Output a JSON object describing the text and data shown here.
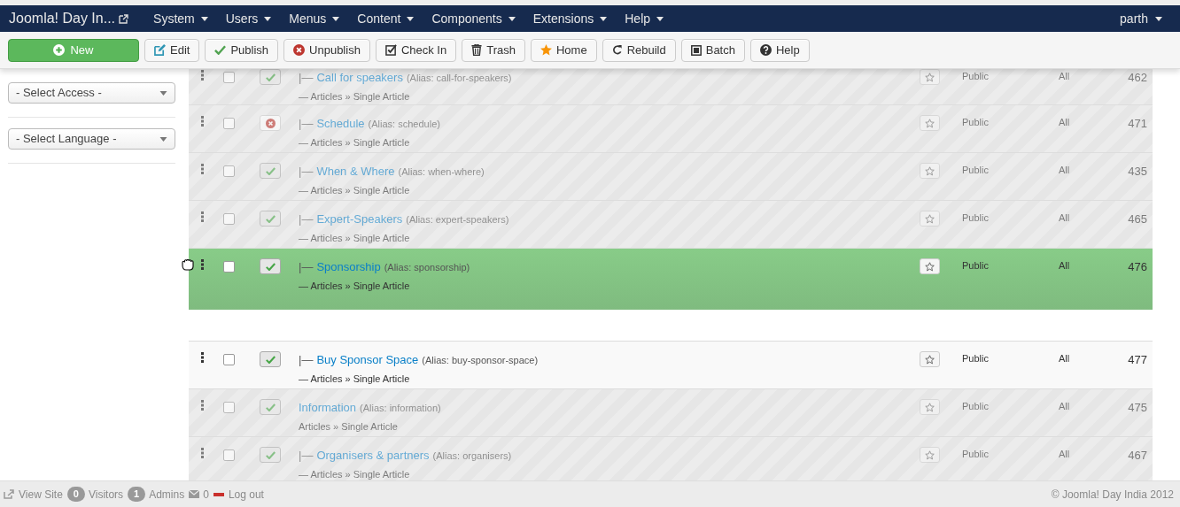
{
  "navbar": {
    "brand": "Joomla! Day In...",
    "menus": [
      {
        "label": "System"
      },
      {
        "label": "Users"
      },
      {
        "label": "Menus"
      },
      {
        "label": "Content"
      },
      {
        "label": "Components"
      },
      {
        "label": "Extensions"
      },
      {
        "label": "Help"
      }
    ],
    "user": "parth"
  },
  "toolbar": [
    {
      "kind": "new",
      "label": "New"
    },
    {
      "kind": "edit",
      "label": "Edit"
    },
    {
      "kind": "publish",
      "label": "Publish"
    },
    {
      "kind": "unpublish",
      "label": "Unpublish"
    },
    {
      "kind": "checkin",
      "label": "Check In"
    },
    {
      "kind": "trash",
      "label": "Trash"
    },
    {
      "kind": "home",
      "label": "Home"
    },
    {
      "kind": "rebuild",
      "label": "Rebuild"
    },
    {
      "kind": "batch",
      "label": "Batch"
    },
    {
      "kind": "help",
      "label": "Help"
    }
  ],
  "filters": [
    {
      "value": "- Select Access -"
    },
    {
      "value": "- Select Language -"
    }
  ],
  "rows": [
    {
      "dimmed": true,
      "dragging": false,
      "published": true,
      "prefix": "|—",
      "title": "Call for speakers",
      "alias": "(Alias: call-for-speakers)",
      "path": "— Articles » Single Article",
      "access": "Public",
      "language": "All",
      "id": "462"
    },
    {
      "dimmed": true,
      "dragging": false,
      "published": false,
      "prefix": "|—",
      "title": "Schedule",
      "alias": "(Alias: schedule)",
      "path": "— Articles » Single Article",
      "access": "Public",
      "language": "All",
      "id": "471"
    },
    {
      "dimmed": true,
      "dragging": false,
      "published": true,
      "prefix": "|—",
      "title": "When & Where",
      "alias": "(Alias: when-where)",
      "path": "— Articles » Single Article",
      "access": "Public",
      "language": "All",
      "id": "435"
    },
    {
      "dimmed": true,
      "dragging": false,
      "published": true,
      "prefix": "|—",
      "title": "Expert-Speakers",
      "alias": "(Alias: expert-speakers)",
      "path": "— Articles » Single Article",
      "access": "Public",
      "language": "All",
      "id": "465"
    },
    {
      "dimmed": false,
      "dragging": true,
      "published": true,
      "prefix": "|—",
      "title": "Sponsorship",
      "alias": "(Alias: sponsorship)",
      "path": "— Articles » Single Article",
      "access": "Public",
      "language": "All",
      "id": "476"
    },
    {
      "dimmed": false,
      "dragging": false,
      "published": true,
      "prefix": "|—",
      "title": "Buy Sponsor Space",
      "alias": "(Alias: buy-sponsor-space)",
      "path": "— Articles » Single Article",
      "access": "Public",
      "language": "All",
      "id": "477"
    },
    {
      "dimmed": true,
      "dragging": false,
      "published": true,
      "title": "Information",
      "alias": "(Alias: information)",
      "path": "Articles » Single Article",
      "access": "Public",
      "language": "All",
      "id": "475"
    },
    {
      "dimmed": true,
      "dragging": false,
      "published": true,
      "prefix": "|—",
      "title": "Organisers & partners",
      "alias": "(Alias: organisers)",
      "path": "— Articles » Single Article",
      "access": "Public",
      "language": "All",
      "id": "467"
    }
  ],
  "status_bar": {
    "view_site": "View Site",
    "visitors_count": "0",
    "visitors": "Visitors",
    "admins_count": "1",
    "admins": "Admins",
    "messages": "0",
    "logout": "Log out",
    "copyright": "© Joomla! Day India 2012"
  }
}
